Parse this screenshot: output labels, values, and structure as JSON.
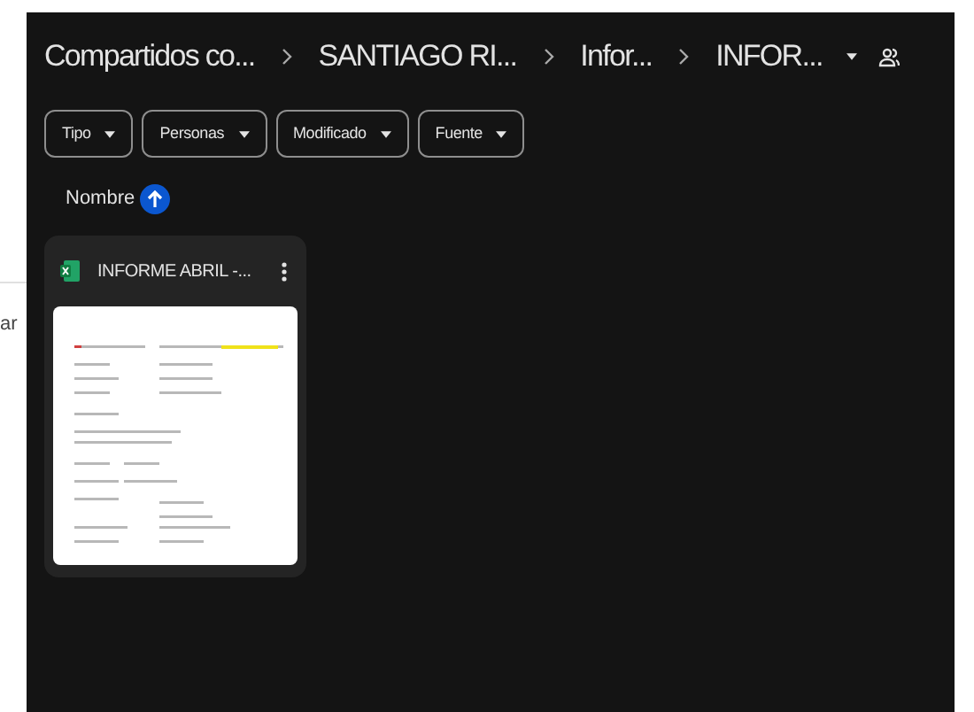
{
  "background_text": "ar",
  "breadcrumbs": [
    "Compartidos co...",
    "SANTIAGO RI...",
    "Infor...",
    "INFOR..."
  ],
  "filters": [
    "Tipo",
    "Personas",
    "Modificado",
    "Fuente"
  ],
  "sort": {
    "label": "Nombre"
  },
  "files": [
    {
      "name": "INFORME ABRIL -..."
    }
  ]
}
